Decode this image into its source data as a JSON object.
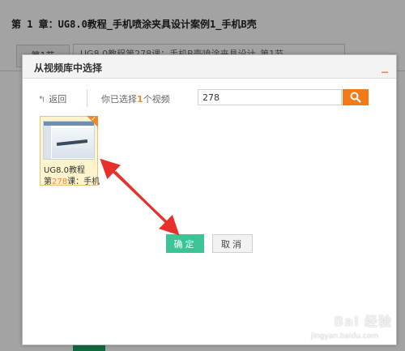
{
  "background": {
    "chapter_title": "第 1 章：UG8.0教程_手机喷涂夹具设计案例1_手机B壳",
    "section_label": "第1节",
    "section_title": "UG8.0教程第278课：手机B壳喷涂夹具设计_第1节"
  },
  "dialog": {
    "title": "从视频库中选择",
    "close_icon": "close-icon",
    "back_label": "返回",
    "selection_prefix": "你已选择",
    "selection_count": "1",
    "selection_suffix": "个视频",
    "search_value": "278",
    "search_icon": "search-icon",
    "accent_color": "#f27a1a",
    "confirm_label": "确定",
    "confirm_color": "#3cc497",
    "cancel_label": "取消"
  },
  "video": {
    "title_line1": "UG8.0教程",
    "title_line2_prefix": "第",
    "title_line2_number": "278",
    "title_line2_suffix": "课：手机",
    "selected": true
  },
  "annotation_color": "#e8302a",
  "watermark": {
    "brand": "Bai 经验",
    "url": "jingyan.baidu.com"
  }
}
